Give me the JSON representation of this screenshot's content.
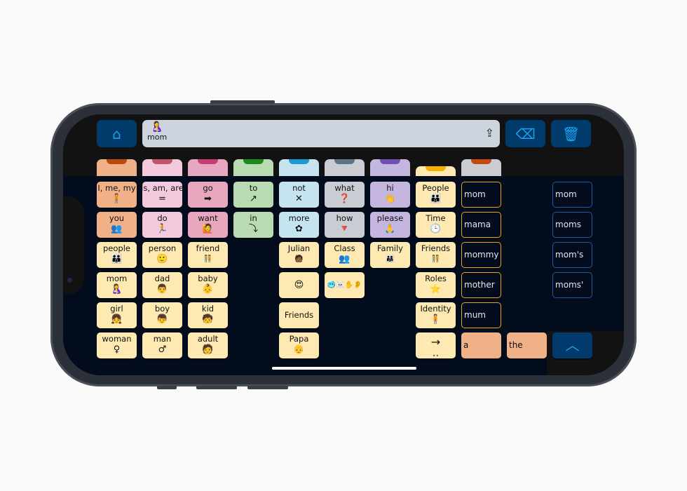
{
  "toolbar": {
    "home_icon": "home-icon",
    "message_word": "mom",
    "message_icon": "person-with-baby-symbol",
    "share_icon": "share-icon",
    "backspace_icon": "backspace-icon",
    "trash_icon": "trash-icon"
  },
  "colors": {
    "orange": "#f0b088",
    "pink_light": "#f2c9dd",
    "pink": "#e8a6bf",
    "green": "#b9dbb1",
    "blue": "#c6e4f0",
    "gray": "#c9ccd3",
    "purple": "#c4b6df",
    "yellow": "#fde9b1",
    "button_blue": "#003b6b",
    "icon_blue": "#1da1f2",
    "outline_orange": "#e8a51a",
    "outline_blue": "#1c5aa0"
  },
  "tabs": [
    {
      "fill": "#f0b088",
      "accent": "#b84a0f"
    },
    {
      "fill": "#f2c9dd",
      "accent": "#c05569"
    },
    {
      "fill": "#e8a6bf",
      "accent": "#c63c78"
    },
    {
      "fill": "#b9dbb1",
      "accent": "#1d8a1d"
    },
    {
      "fill": "#c6e4f0",
      "accent": "#1a98d0"
    },
    {
      "fill": "#c9ccd3",
      "accent": "#5f7388"
    },
    {
      "fill": "#c4b6df",
      "accent": "#7051b0"
    },
    {
      "fill": "#fde9b1",
      "accent": "#f5b000"
    },
    {
      "fill": "#c9ccd3",
      "accent": "#c24a10"
    }
  ],
  "columns": [
    [
      {
        "label": "I, me, my",
        "icon": "🧍",
        "color": "orange"
      },
      {
        "label": "you",
        "icon": "👥",
        "color": "orange"
      },
      {
        "label": "people",
        "icon": "👪",
        "color": "yellow"
      },
      {
        "label": "mom",
        "icon": "🤱",
        "color": "yellow"
      },
      {
        "label": "girl",
        "icon": "👧",
        "color": "yellow"
      },
      {
        "label": "woman",
        "icon": "♀",
        "color": "yellow"
      }
    ],
    [
      {
        "label": "is, am, are",
        "icon": "=",
        "color": "pink_light"
      },
      {
        "label": "do",
        "icon": "🏃",
        "color": "pink_light"
      },
      {
        "label": "person",
        "icon": "🙂",
        "color": "yellow"
      },
      {
        "label": "dad",
        "icon": "👨",
        "color": "yellow"
      },
      {
        "label": "boy",
        "icon": "👦",
        "color": "yellow"
      },
      {
        "label": "man",
        "icon": "♂",
        "color": "yellow"
      }
    ],
    [
      {
        "label": "go",
        "icon": "➡",
        "color": "pink"
      },
      {
        "label": "want",
        "icon": "🙋",
        "color": "pink"
      },
      {
        "label": "friend",
        "icon": "🧑‍🤝‍🧑",
        "color": "yellow"
      },
      {
        "label": "baby",
        "icon": "👶",
        "color": "yellow"
      },
      {
        "label": "kid",
        "icon": "🧒",
        "color": "yellow"
      },
      {
        "label": "adult",
        "icon": "🧑",
        "color": "yellow"
      }
    ],
    [
      {
        "label": "to",
        "icon": "↗",
        "color": "green"
      },
      {
        "label": "in",
        "icon": "⤵",
        "color": "green"
      },
      null,
      null,
      null,
      null
    ],
    [
      {
        "label": "not",
        "icon": "✕",
        "color": "blue"
      },
      {
        "label": "more",
        "icon": "✿",
        "color": "blue"
      },
      {
        "label": "Julian",
        "icon": "🧑🏾",
        "color": "yellow"
      },
      {
        "label": "",
        "icon": "😍",
        "color": "yellow"
      },
      {
        "label": "Friends",
        "icon": "",
        "color": "yellow"
      },
      {
        "label": "Papa",
        "icon": "👴",
        "color": "yellow"
      }
    ],
    [
      {
        "label": "what",
        "icon": "❓",
        "color": "gray"
      },
      {
        "label": "how",
        "icon": "🔻",
        "color": "gray"
      },
      {
        "label": "Class",
        "icon": "👥",
        "color": "yellow"
      },
      {
        "label": "",
        "icon": "🥶☠️✋👂",
        "color": "yellow"
      },
      null,
      null
    ],
    [
      {
        "label": "hi",
        "icon": "👋",
        "color": "purple"
      },
      {
        "label": "please",
        "icon": "🙏",
        "color": "purple"
      },
      {
        "label": "Family",
        "icon": "👨‍👩‍👧",
        "color": "yellow"
      },
      null,
      null,
      null
    ],
    [
      {
        "label": "People",
        "icon": "👪",
        "color": "yellow"
      },
      {
        "label": "Time",
        "icon": "🕒",
        "color": "yellow"
      },
      {
        "label": "Friends",
        "icon": "🧑‍🤝‍🧑",
        "color": "yellow"
      },
      {
        "label": "Roles",
        "icon": "⭐",
        "color": "yellow"
      },
      {
        "label": "Identity",
        "icon": "🧍",
        "color": "yellow"
      },
      {
        "label": "→",
        "icon": "••",
        "color": "yellow"
      }
    ],
    [
      {
        "label": "mom",
        "style": "word-orange"
      },
      {
        "label": "mama",
        "style": "word-orange"
      },
      {
        "label": "mommy",
        "style": "word-orange"
      },
      {
        "label": "mother",
        "style": "word-orange"
      },
      {
        "label": "mum",
        "style": "word-orange"
      },
      {
        "label": "a",
        "style": "fill-orange"
      }
    ],
    [
      null,
      null,
      null,
      null,
      null,
      {
        "label": "the",
        "style": "fill-orange"
      }
    ],
    [
      {
        "label": "mom",
        "style": "word-blue"
      },
      {
        "label": "moms",
        "style": "word-blue"
      },
      {
        "label": "mom's",
        "style": "word-blue"
      },
      {
        "label": "moms'",
        "style": "word-blue"
      },
      null,
      {
        "label": "︿",
        "style": "button-blue"
      }
    ]
  ]
}
